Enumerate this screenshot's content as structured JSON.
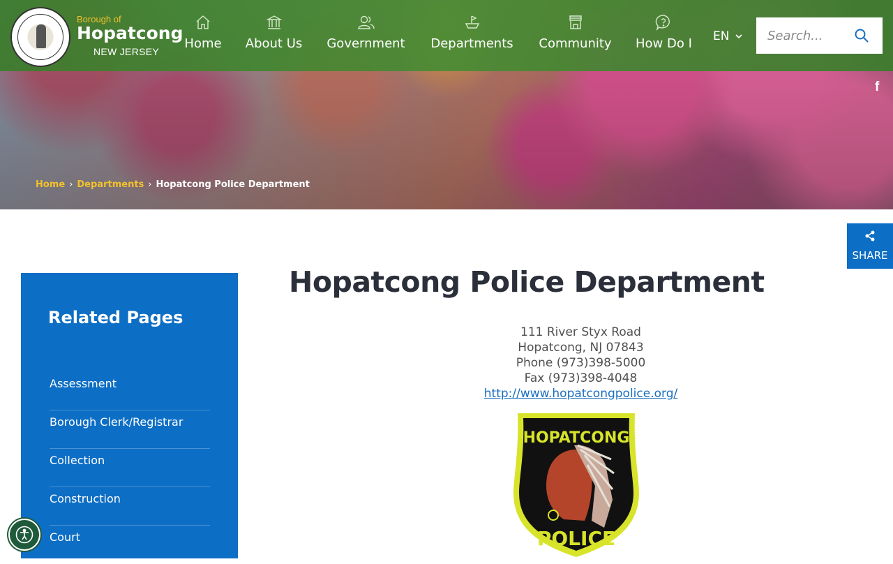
{
  "header": {
    "brand_small": "Borough of",
    "brand_name": "Hopatcong",
    "brand_state": "NEW JERSEY",
    "nav": [
      {
        "label": "Home",
        "icon": "home-icon"
      },
      {
        "label": "About Us",
        "icon": "building-icon"
      },
      {
        "label": "Government",
        "icon": "people-icon"
      },
      {
        "label": "Departments",
        "icon": "flag-boat-icon"
      },
      {
        "label": "Community",
        "icon": "storefront-icon"
      },
      {
        "label": "How Do I",
        "icon": "question-icon"
      }
    ],
    "language": "EN",
    "search": {
      "placeholder": "Search..."
    }
  },
  "social": {
    "facebook": "f"
  },
  "breadcrumb": {
    "home": "Home",
    "departments": "Departments",
    "current": "Hopatcong Police Department"
  },
  "share": {
    "label": "SHARE"
  },
  "sidebar": {
    "title": "Related Pages",
    "items": [
      {
        "label": "Assessment"
      },
      {
        "label": "Borough Clerk/Registrar"
      },
      {
        "label": "Collection"
      },
      {
        "label": "Construction"
      },
      {
        "label": "Court"
      }
    ]
  },
  "main": {
    "title": "Hopatcong Police Department",
    "address1": "111 River Styx Road",
    "address2": "Hopatcong, NJ 07843",
    "phone": "Phone (973)398-5000",
    "fax": "Fax (973)398-4048",
    "website": "http://www.hopatcongpolice.org/",
    "badge_top": "HOPATCONG",
    "badge_bottom": "POLICE"
  },
  "colors": {
    "header_green": "#3a7d2c",
    "accent_blue": "#0d6ec5",
    "breadcrumb_gold": "#f2c12e",
    "title_dark": "#2b2f3a"
  }
}
